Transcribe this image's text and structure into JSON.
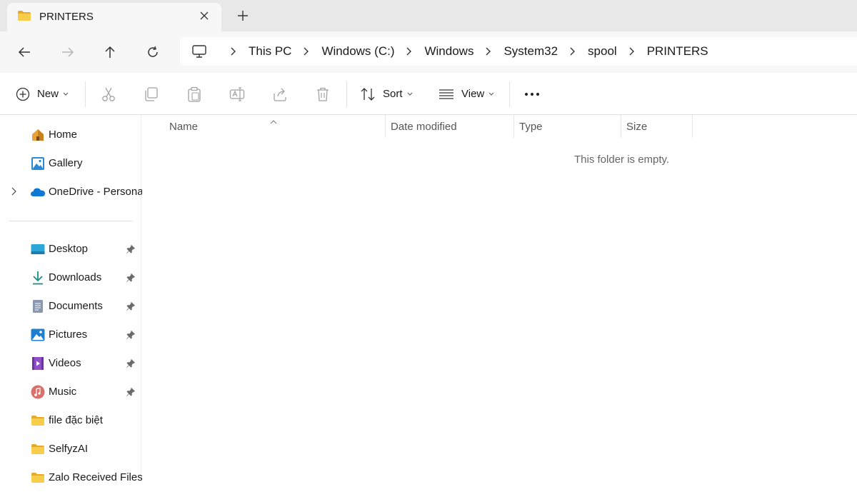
{
  "tab": {
    "title": "PRINTERS",
    "close_glyph": "×",
    "new_tab_glyph": "+"
  },
  "address": {
    "crumbs": [
      "This PC",
      "Windows (C:)",
      "Windows",
      "System32",
      "spool",
      "PRINTERS"
    ]
  },
  "commands": {
    "new_label": "New",
    "sort_label": "Sort",
    "view_label": "View",
    "more_glyph": "•••"
  },
  "sidebar": {
    "items": [
      {
        "label": "Home",
        "icon": "home-icon"
      },
      {
        "label": "Gallery",
        "icon": "gallery-icon"
      },
      {
        "label": "OneDrive - Persona",
        "icon": "onedrive-icon"
      },
      {
        "label": "Desktop",
        "icon": "desktop-icon",
        "pinned": true
      },
      {
        "label": "Downloads",
        "icon": "downloads-icon",
        "pinned": true
      },
      {
        "label": "Documents",
        "icon": "documents-icon",
        "pinned": true
      },
      {
        "label": "Pictures",
        "icon": "pictures-icon",
        "pinned": true
      },
      {
        "label": "Videos",
        "icon": "videos-icon",
        "pinned": true
      },
      {
        "label": "Music",
        "icon": "music-icon",
        "pinned": true
      },
      {
        "label": "file đặc biệt",
        "icon": "folder-icon"
      },
      {
        "label": "SelfyzAI",
        "icon": "folder-icon"
      },
      {
        "label": "Zalo Received Files",
        "icon": "folder-icon"
      }
    ]
  },
  "columns": [
    "Name",
    "Date modified",
    "Type",
    "Size"
  ],
  "empty_message": "This folder is empty.",
  "colors": {
    "accent": "#0067c0",
    "folder": "#f3c344",
    "tab_strip": "#e8e8e8",
    "address_row": "#f7f7f7"
  }
}
